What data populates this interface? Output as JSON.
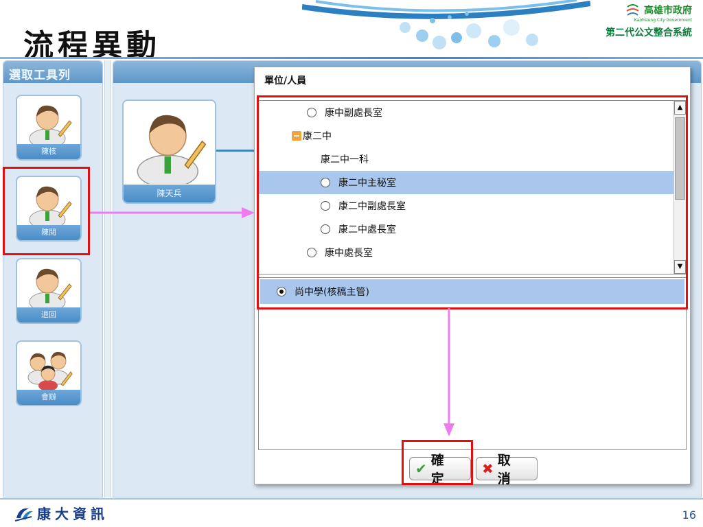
{
  "slide": {
    "title": "流程異動",
    "page_number": "16",
    "gov_name": "高雄市政府",
    "gov_name_en": "Kaohsiung City Government",
    "gov_system": "第二代公文整合系統",
    "footer_brand": "康大資訊"
  },
  "tool_panel": {
    "header": "選取工具列",
    "tools": [
      {
        "label": "陳核"
      },
      {
        "label": "陳閱"
      },
      {
        "label": "退回"
      },
      {
        "label": "會辦"
      }
    ]
  },
  "canvas": {
    "node_label": "陳天兵"
  },
  "dialog": {
    "title": "單位/人員",
    "tree": [
      {
        "label": "康中副處長室"
      },
      {
        "label": "康二中"
      },
      {
        "label": "康二中一科"
      },
      {
        "label": "康二中主秘室"
      },
      {
        "label": "康二中副處長室"
      },
      {
        "label": "康二中處長室"
      },
      {
        "label": "康中處長室"
      }
    ],
    "selected_label": "尚中學(核稿主管)",
    "confirm_label": "確 定",
    "cancel_label": "取 消"
  },
  "colors": {
    "highlight_red": "#e01010",
    "arrow_pink": "#ee7cee",
    "selection_blue": "#a9c6ec",
    "header_blue": "#5d97c9"
  }
}
